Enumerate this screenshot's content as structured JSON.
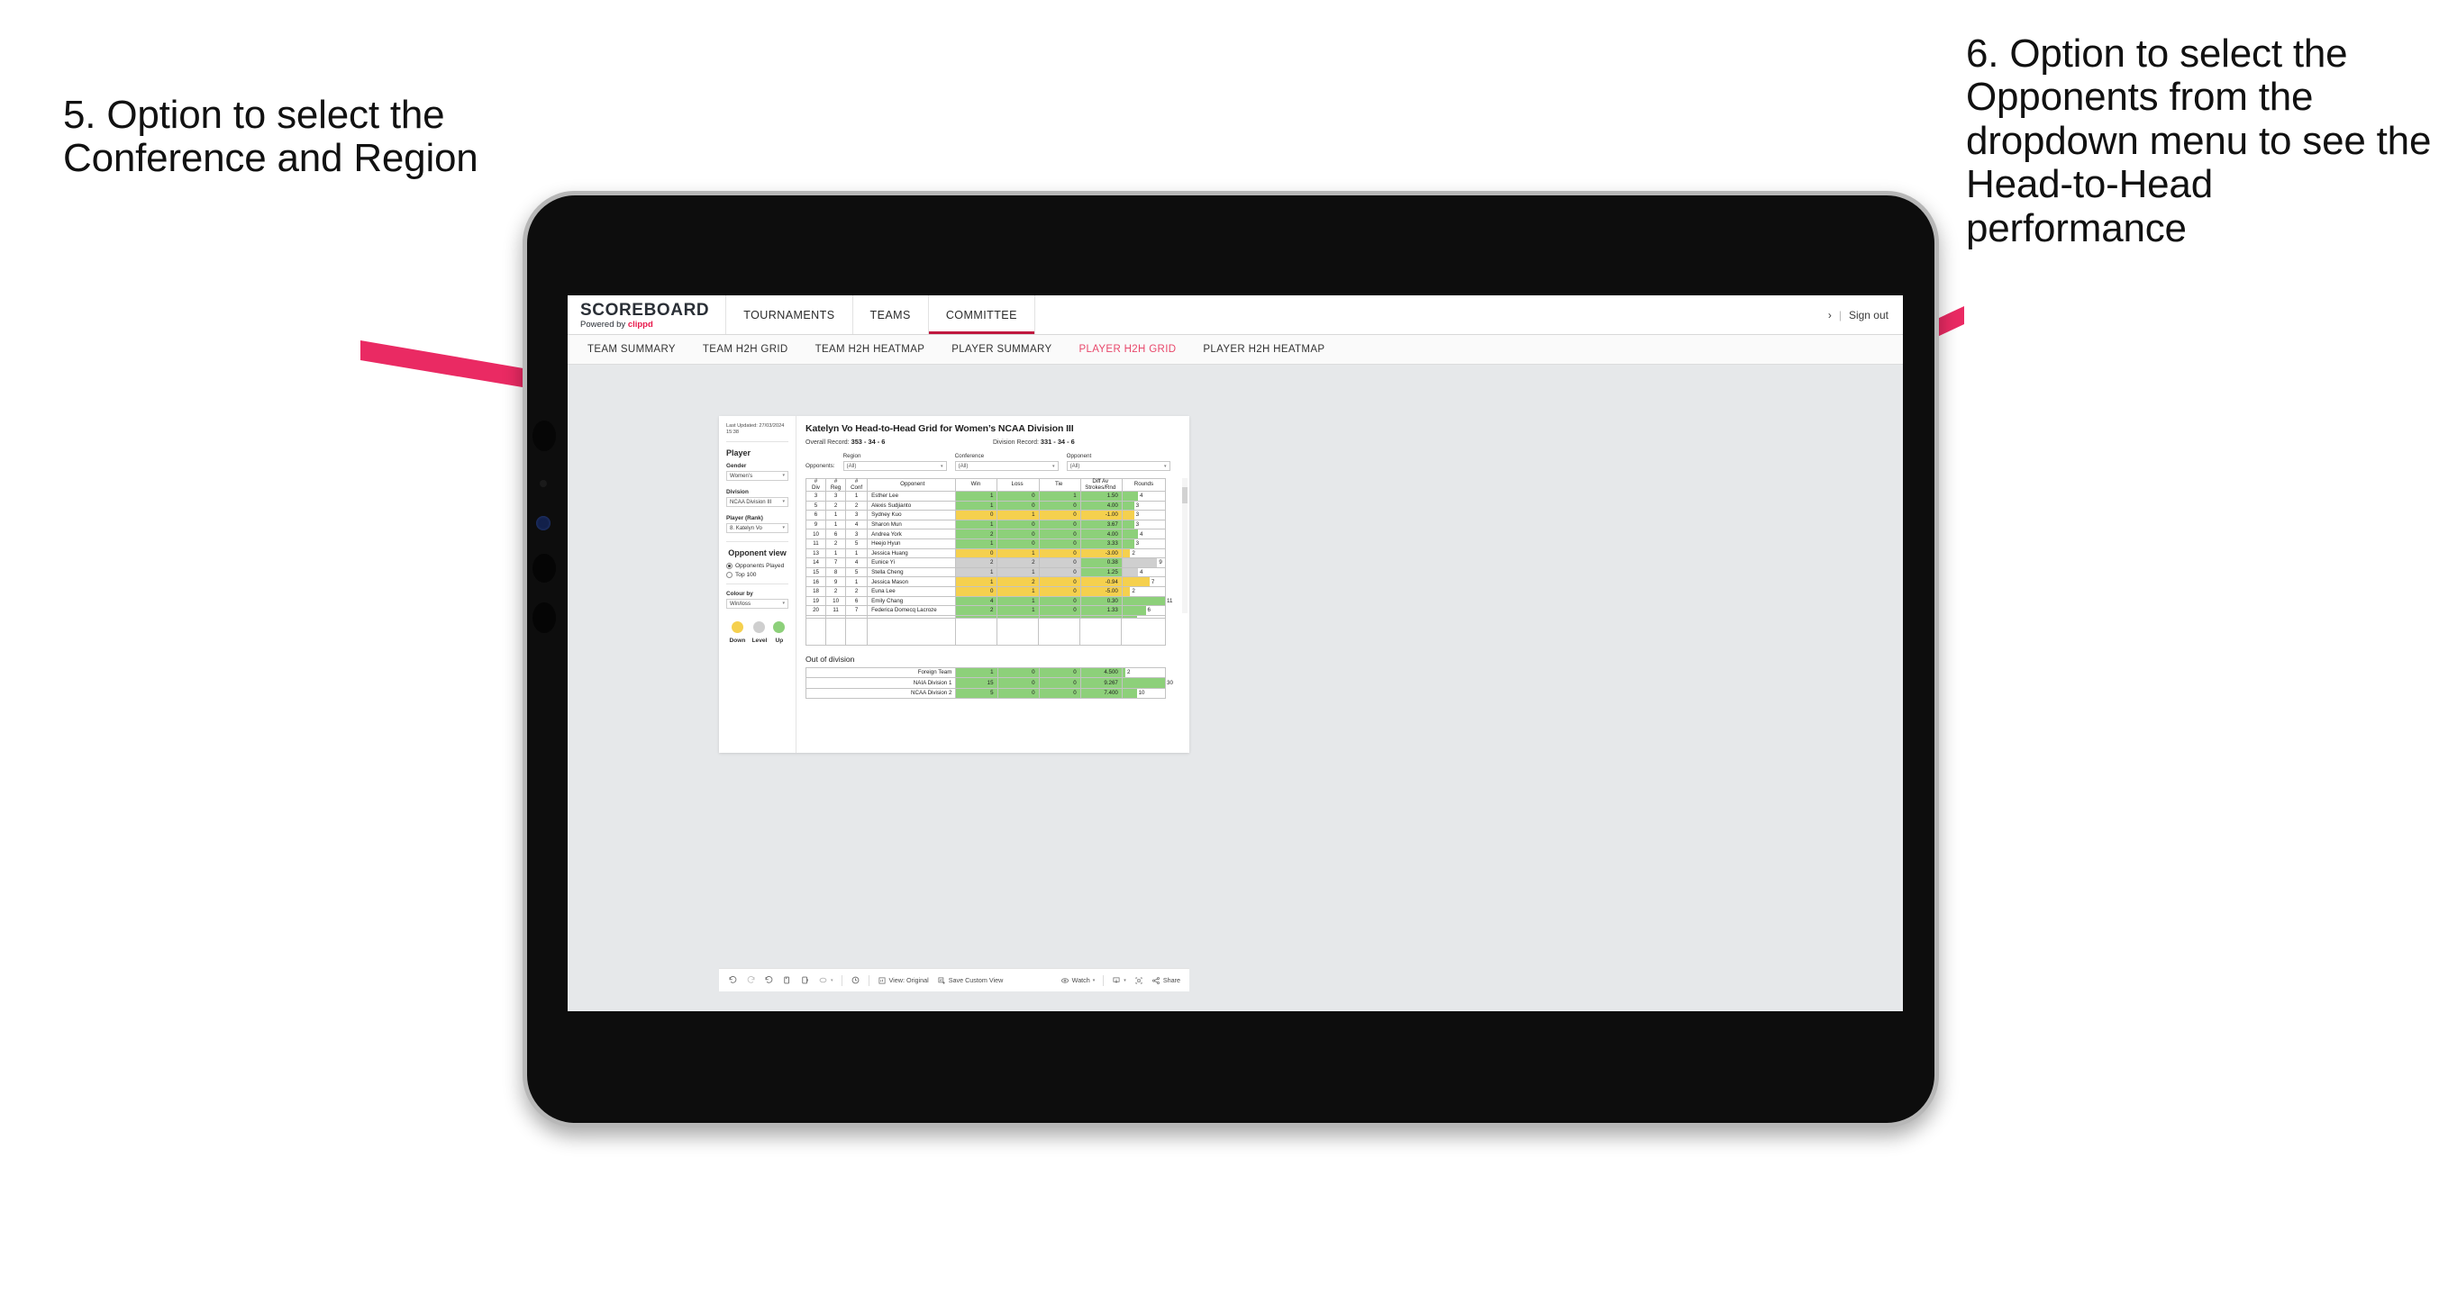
{
  "annotations": {
    "left": "5. Option to select the Conference and Region",
    "right": "6. Option to select the Opponents from the dropdown menu to see the Head-to-Head performance"
  },
  "colors": {
    "accent_pink": "#e8174a",
    "tab_active": "#e8486b",
    "up_green": "#8dd07a",
    "down_yellow": "#f5d04e",
    "level_grey": "#cfcfcf"
  },
  "topnav": {
    "brand_title": "SCOREBOARD",
    "brand_sub_prefix": "Powered by ",
    "brand_sub_name": "clippd",
    "items": [
      {
        "label": "TOURNAMENTS",
        "active": false
      },
      {
        "label": "TEAMS",
        "active": false
      },
      {
        "label": "COMMITTEE",
        "active": true
      }
    ],
    "chevron": "›",
    "separator": "|",
    "sign_out": "Sign out"
  },
  "subnav": {
    "tabs": [
      {
        "label": "TEAM SUMMARY",
        "active": false
      },
      {
        "label": "TEAM H2H GRID",
        "active": false
      },
      {
        "label": "TEAM H2H HEATMAP",
        "active": false
      },
      {
        "label": "PLAYER SUMMARY",
        "active": false
      },
      {
        "label": "PLAYER H2H GRID",
        "active": true
      },
      {
        "label": "PLAYER H2H HEATMAP",
        "active": false
      }
    ]
  },
  "panel": {
    "last_updated": "Last Updated: 27/03/2024 15:38",
    "player_heading": "Player",
    "gender_label": "Gender",
    "gender_value": "Women’s",
    "division_label": "Division",
    "division_value": "NCAA Division III",
    "player_rank_label": "Player (Rank)",
    "player_rank_value": "8. Katelyn Vo",
    "opponent_view_heading": "Opponent view",
    "opponent_view_options": [
      {
        "label": "Opponents Played",
        "selected": true
      },
      {
        "label": "Top 100",
        "selected": false
      }
    ],
    "colour_by_label": "Colour by",
    "colour_by_value": "Win/loss",
    "legend": [
      {
        "caption": "Down",
        "color": "#f5d04e"
      },
      {
        "caption": "Level",
        "color": "#cfcfcf"
      },
      {
        "caption": "Up",
        "color": "#8dd07a"
      }
    ],
    "caret": "▾"
  },
  "viz": {
    "title": "Katelyn Vo Head-to-Head Grid for Women’s NCAA Division III",
    "overall_record_label": "Overall Record: ",
    "overall_record_value": "353 - 34 - 6",
    "division_record_label": "Division Record: ",
    "division_record_value": "331 - 34 - 6",
    "opponents_label": "Opponents:",
    "filters": [
      {
        "label": "Region",
        "value": "(All)"
      },
      {
        "label": "Conference",
        "value": "(All)"
      },
      {
        "label": "Opponent",
        "value": "(All)"
      }
    ],
    "caret": "▾"
  },
  "chart_data": {
    "type": "table",
    "title": "Katelyn Vo Head-to-Head Grid for Women’s NCAA Division III",
    "columns": [
      "# Div",
      "# Reg",
      "# Conf",
      "Opponent",
      "Win",
      "Loss",
      "Tie",
      "Diff Av Strokes/Rnd",
      "Rounds"
    ],
    "header_lines": [
      [
        "#",
        "Div"
      ],
      [
        "#",
        "Reg"
      ],
      [
        "#",
        "Conf"
      ],
      [
        "Opponent"
      ],
      [
        "Win"
      ],
      [
        "Loss"
      ],
      [
        "Tie"
      ],
      [
        "Diff Av",
        "Strokes/Rnd"
      ],
      [
        "Rounds"
      ]
    ],
    "rounds_max": 11,
    "rows": [
      {
        "div": "3",
        "reg": "3",
        "conf": "1",
        "opponent": "Esther Lee",
        "win": "1",
        "loss": "0",
        "tie": "1",
        "diff": "1.50",
        "rounds": "4",
        "color": "green"
      },
      {
        "div": "5",
        "reg": "2",
        "conf": "2",
        "opponent": "Alexis Sudjianto",
        "win": "1",
        "loss": "0",
        "tie": "0",
        "diff": "4.00",
        "rounds": "3",
        "color": "green"
      },
      {
        "div": "6",
        "reg": "1",
        "conf": "3",
        "opponent": "Sydney Kuo",
        "win": "0",
        "loss": "1",
        "tie": "0",
        "diff": "-1.00",
        "rounds": "3",
        "color": "yellow"
      },
      {
        "div": "9",
        "reg": "1",
        "conf": "4",
        "opponent": "Sharon Mun",
        "win": "1",
        "loss": "0",
        "tie": "0",
        "diff": "3.67",
        "rounds": "3",
        "color": "green"
      },
      {
        "div": "10",
        "reg": "6",
        "conf": "3",
        "opponent": "Andrea York",
        "win": "2",
        "loss": "0",
        "tie": "0",
        "diff": "4.00",
        "rounds": "4",
        "color": "green"
      },
      {
        "div": "11",
        "reg": "2",
        "conf": "5",
        "opponent": "Heejo Hyun",
        "win": "1",
        "loss": "0",
        "tie": "0",
        "diff": "3.33",
        "rounds": "3",
        "color": "green"
      },
      {
        "div": "13",
        "reg": "1",
        "conf": "1",
        "opponent": "Jessica Huang",
        "win": "0",
        "loss": "1",
        "tie": "0",
        "diff": "-3.00",
        "rounds": "2",
        "color": "yellow"
      },
      {
        "div": "14",
        "reg": "7",
        "conf": "4",
        "opponent": "Eunice Yi",
        "win": "2",
        "loss": "2",
        "tie": "0",
        "diff": "0.38",
        "rounds": "9",
        "color": "grey"
      },
      {
        "div": "15",
        "reg": "8",
        "conf": "5",
        "opponent": "Stella Cheng",
        "win": "1",
        "loss": "1",
        "tie": "0",
        "diff": "1.25",
        "rounds": "4",
        "color": "grey"
      },
      {
        "div": "16",
        "reg": "9",
        "conf": "1",
        "opponent": "Jessica Mason",
        "win": "1",
        "loss": "2",
        "tie": "0",
        "diff": "-0.94",
        "rounds": "7",
        "color": "yellow"
      },
      {
        "div": "18",
        "reg": "2",
        "conf": "2",
        "opponent": "Euna Lee",
        "win": "0",
        "loss": "1",
        "tie": "0",
        "diff": "-5.00",
        "rounds": "2",
        "color": "yellow"
      },
      {
        "div": "19",
        "reg": "10",
        "conf": "6",
        "opponent": "Emily Chang",
        "win": "4",
        "loss": "1",
        "tie": "0",
        "diff": "0.30",
        "rounds": "11",
        "color": "green"
      },
      {
        "div": "20",
        "reg": "11",
        "conf": "7",
        "opponent": "Federica Domecq Lacroze",
        "win": "2",
        "loss": "1",
        "tie": "0",
        "diff": "1.33",
        "rounds": "6",
        "color": "green"
      }
    ],
    "out_of_division_title": "Out of division",
    "out_of_division": [
      {
        "name": "Foreign Team",
        "win": "1",
        "loss": "0",
        "tie": "0",
        "diff": "4.500",
        "rounds": "2",
        "color": "green"
      },
      {
        "name": "NAIA Division 1",
        "win": "15",
        "loss": "0",
        "tie": "0",
        "diff": "9.267",
        "rounds": "30",
        "color": "green"
      },
      {
        "name": "NCAA Division 2",
        "win": "5",
        "loss": "0",
        "tie": "0",
        "diff": "7.400",
        "rounds": "10",
        "color": "green"
      }
    ],
    "ood_rounds_max": 30
  },
  "toolstrip": {
    "view_label": "View: Original",
    "save_label": "Save Custom View",
    "watch_label": "Watch",
    "share_label": "Share",
    "caret": "▾"
  }
}
